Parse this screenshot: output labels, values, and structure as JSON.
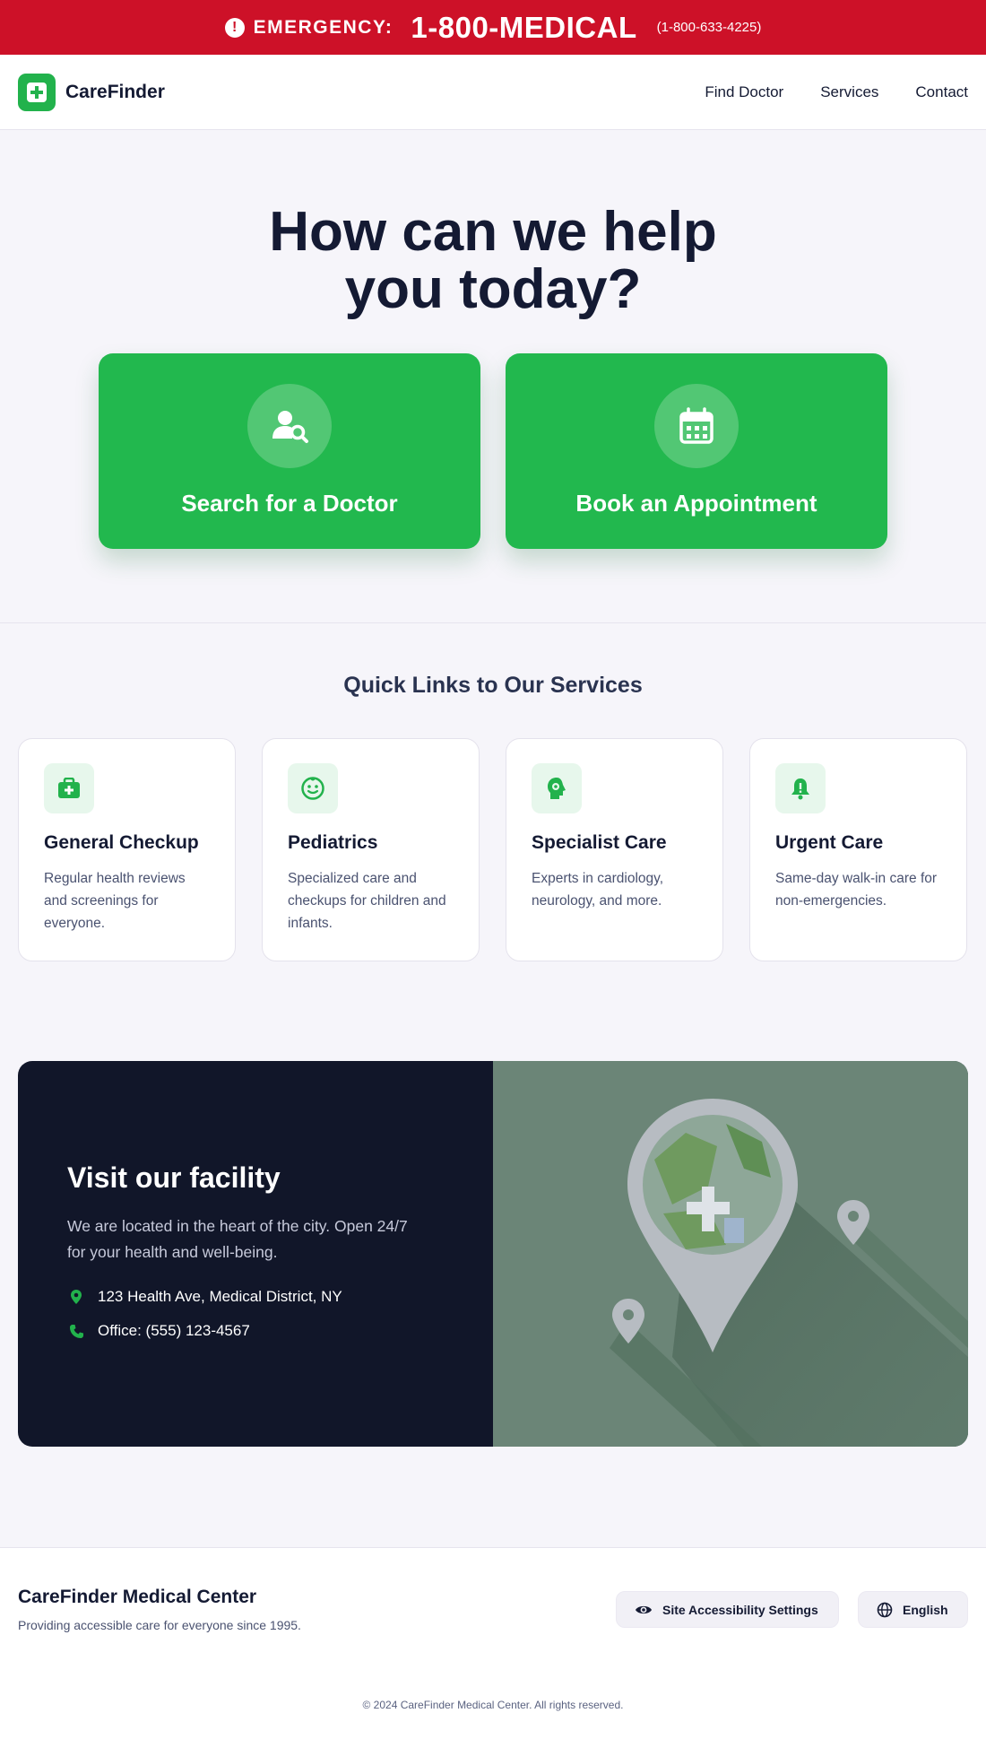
{
  "emergency": {
    "label": "EMERGENCY:",
    "number": "1-800-MEDICAL",
    "alt_number": "(1-800-633-4225)"
  },
  "header": {
    "brand": "CareFinder",
    "nav": [
      "Find Doctor",
      "Services",
      "Contact"
    ]
  },
  "hero": {
    "title_line1": "How can we help",
    "title_line2": "you today?",
    "actions": [
      {
        "label": "Search for a Doctor",
        "icon": "user-search-icon"
      },
      {
        "label": "Book an Appointment",
        "icon": "calendar-icon"
      }
    ]
  },
  "services": {
    "title": "Quick Links to Our Services",
    "items": [
      {
        "title": "General Checkup",
        "desc": "Regular health reviews and screenings for everyone.",
        "icon": "medkit-icon"
      },
      {
        "title": "Pediatrics",
        "desc": "Specialized care and checkups for children and infants.",
        "icon": "baby-face-icon"
      },
      {
        "title": "Specialist Care",
        "desc": "Experts in cardiology, neurology, and more.",
        "icon": "head-gear-icon"
      },
      {
        "title": "Urgent Care",
        "desc": "Same-day walk-in care for non-emergencies.",
        "icon": "bell-alert-icon"
      }
    ]
  },
  "facility": {
    "title": "Visit our facility",
    "desc": "We are located in the heart of the city. Open 24/7 for your health and well-being.",
    "address": "123 Health Ave, Medical District, NY",
    "phone": "Office: (555) 123-4567"
  },
  "footer": {
    "name": "CareFinder Medical Center",
    "tagline": "Providing accessible care for everyone since 1995.",
    "accessibility_label": "Site Accessibility Settings",
    "language_label": "English",
    "copyright": "© 2024 CareFinder Medical Center. All rights reserved."
  },
  "colors": {
    "emergency_red": "#cd1128",
    "brand_green": "#22b84e",
    "dark_navy": "#111629",
    "map_green": "#6b8577"
  }
}
